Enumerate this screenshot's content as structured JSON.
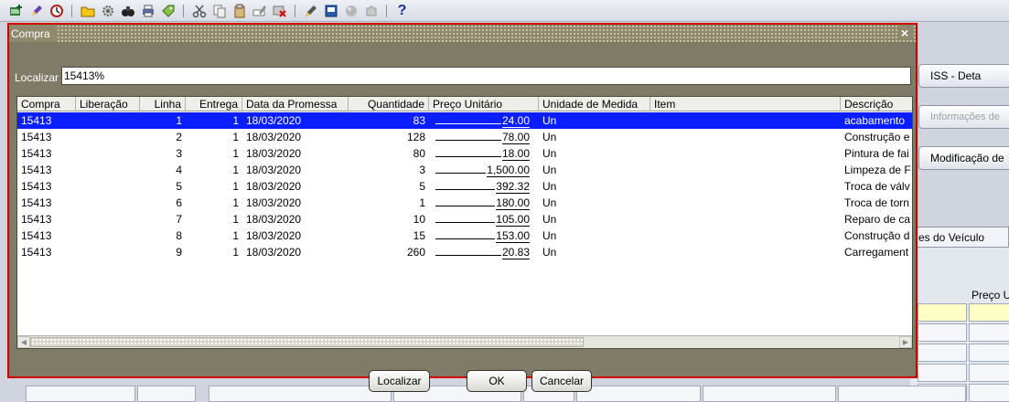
{
  "colors": {
    "selection": "#0a1eff",
    "window_border": "#d40000",
    "dialog_background": "#807b66",
    "highlight_cell": "#ffffc6"
  },
  "toolbar": {
    "icons": [
      "new-record-icon",
      "edit-icon",
      "clock-icon",
      "folder-icon",
      "settings-icon",
      "binoculars-icon",
      "print-icon",
      "tag-icon",
      "cut-icon",
      "copy-icon",
      "paste-icon",
      "edit-field-icon",
      "delete-record-icon",
      "pen-icon",
      "attachment-icon",
      "globe-icon",
      "puzzle-icon"
    ],
    "help_label": "?"
  },
  "background_form": {
    "iss_button": "ISS - Deta",
    "info_button": "Informações de",
    "modify_button": "Modificação de",
    "vehicle_tab": "es do Veículo",
    "price_label": "Preço U"
  },
  "dialog": {
    "title": "Compra",
    "close_label": "×",
    "find_label": "Localizar",
    "find_value": "15413%",
    "columns": [
      "Compra",
      "Liberação",
      "Linha",
      "Entrega",
      "Data da Promessa",
      "Quantidade",
      "Preço Unitário",
      "Unidade de Medida",
      "Item",
      "Descrição"
    ],
    "rows": [
      {
        "compra": "15413",
        "liberacao": "",
        "linha": "1",
        "entrega": "1",
        "data": "18/03/2020",
        "quantidade": "83",
        "preco": "24.00",
        "unidade": "Un",
        "item": "",
        "descricao": "acabamento"
      },
      {
        "compra": "15413",
        "liberacao": "",
        "linha": "2",
        "entrega": "1",
        "data": "18/03/2020",
        "quantidade": "128",
        "preco": "78.00",
        "unidade": "Un",
        "item": "",
        "descricao": "Construção e"
      },
      {
        "compra": "15413",
        "liberacao": "",
        "linha": "3",
        "entrega": "1",
        "data": "18/03/2020",
        "quantidade": "80",
        "preco": "18.00",
        "unidade": "Un",
        "item": "",
        "descricao": "Pintura de fai"
      },
      {
        "compra": "15413",
        "liberacao": "",
        "linha": "4",
        "entrega": "1",
        "data": "18/03/2020",
        "quantidade": "3",
        "preco": "1,500.00",
        "unidade": "Un",
        "item": "",
        "descricao": "Limpeza de F"
      },
      {
        "compra": "15413",
        "liberacao": "",
        "linha": "5",
        "entrega": "1",
        "data": "18/03/2020",
        "quantidade": "5",
        "preco": "392.32",
        "unidade": "Un",
        "item": "",
        "descricao": "Troca de válv"
      },
      {
        "compra": "15413",
        "liberacao": "",
        "linha": "6",
        "entrega": "1",
        "data": "18/03/2020",
        "quantidade": "1",
        "preco": "180.00",
        "unidade": "Un",
        "item": "",
        "descricao": "Troca de torn"
      },
      {
        "compra": "15413",
        "liberacao": "",
        "linha": "7",
        "entrega": "1",
        "data": "18/03/2020",
        "quantidade": "10",
        "preco": "105.00",
        "unidade": "Un",
        "item": "",
        "descricao": "Reparo de ca"
      },
      {
        "compra": "15413",
        "liberacao": "",
        "linha": "8",
        "entrega": "1",
        "data": "18/03/2020",
        "quantidade": "15",
        "preco": "153.00",
        "unidade": "Un",
        "item": "",
        "descricao": "Construção d"
      },
      {
        "compra": "15413",
        "liberacao": "",
        "linha": "9",
        "entrega": "1",
        "data": "18/03/2020",
        "quantidade": "260",
        "preco": "20.83",
        "unidade": "Un",
        "item": "",
        "descricao": "Carregament"
      }
    ],
    "selected_row_index": 0,
    "buttons": {
      "find": "Localizar",
      "ok": "OK",
      "cancel": "Cancelar"
    }
  }
}
